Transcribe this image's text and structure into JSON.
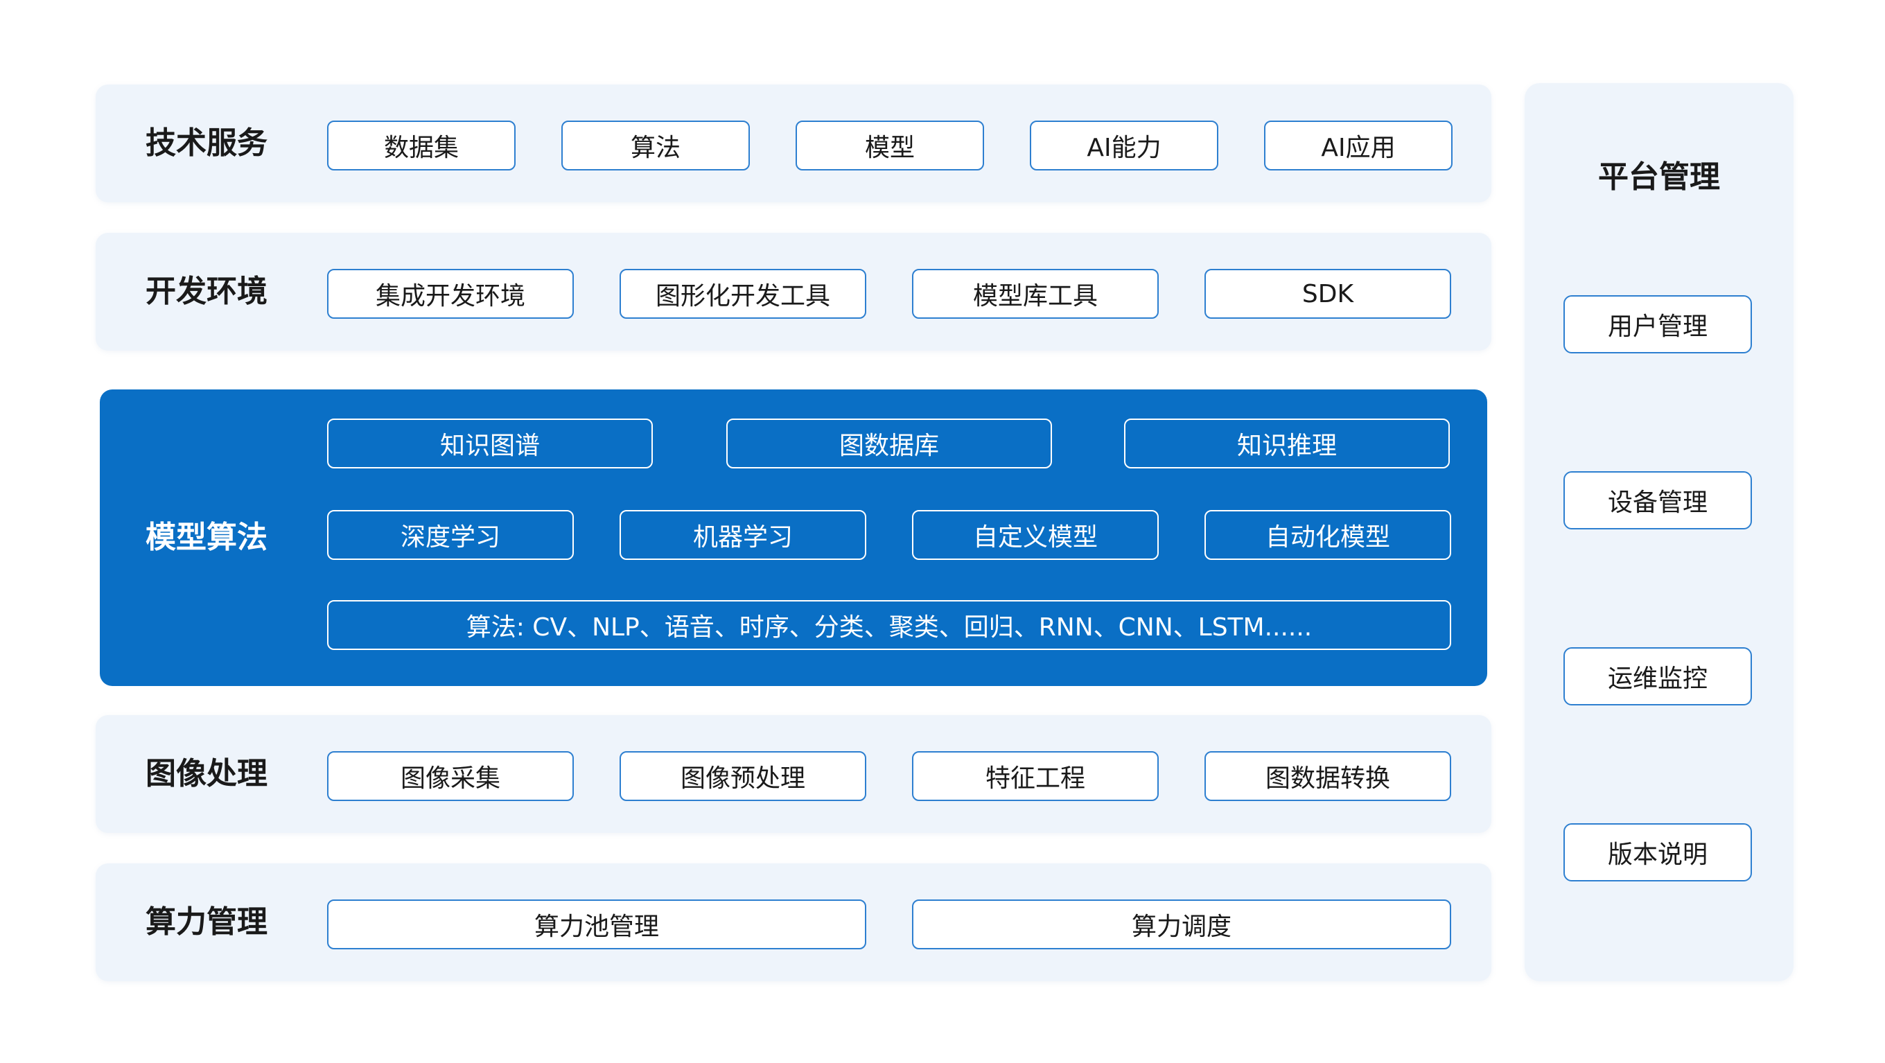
{
  "layers": [
    {
      "title": "技术服务",
      "items": [
        "数据集",
        "算法",
        "模型",
        "AI能力",
        "AI应用"
      ]
    },
    {
      "title": "开发环境",
      "items": [
        "集成开发环境",
        "图形化开发工具",
        "模型库工具",
        "SDK"
      ]
    },
    {
      "title": "模型算法",
      "row1": [
        "知识图谱",
        "图数据库",
        "知识推理"
      ],
      "row2": [
        "深度学习",
        "机器学习",
        "自定义模型",
        "自动化模型"
      ],
      "row3": "算法: CV、NLP、语音、时序、分类、聚类、回归、RNN、CNN、LSTM......"
    },
    {
      "title": "图像处理",
      "items": [
        "图像采集",
        "图像预处理",
        "特征工程",
        "图数据转换"
      ]
    },
    {
      "title": "算力管理",
      "items": [
        "算力池管理",
        "算力调度"
      ]
    }
  ],
  "platform": {
    "title": "平台管理",
    "items": [
      "用户管理",
      "设备管理",
      "运维监控",
      "版本说明"
    ]
  },
  "colors": {
    "layer_bg": "#eef4fb",
    "highlight_bg": "#0a6fc5",
    "pill_border": "#2d7fd0"
  }
}
